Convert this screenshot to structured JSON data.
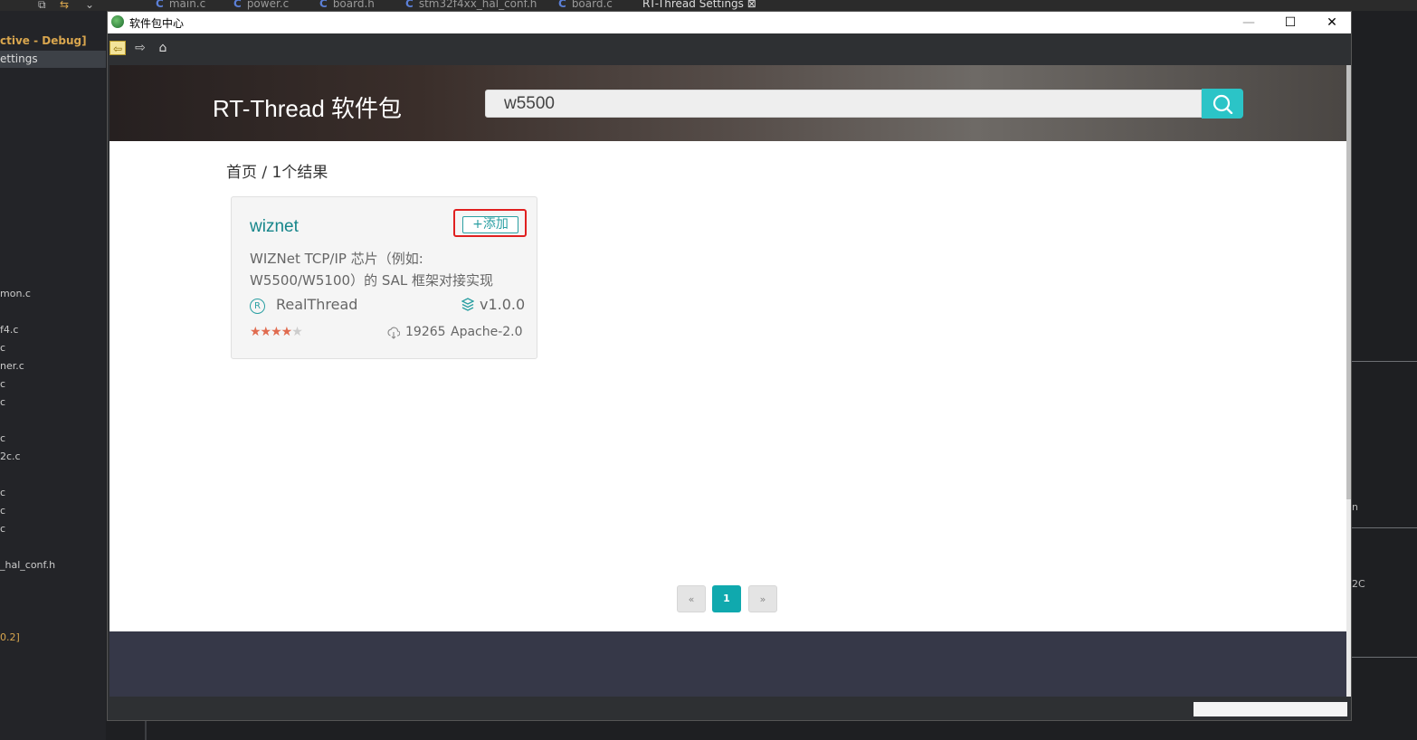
{
  "ide": {
    "tabs": [
      "main.c",
      "power.c",
      "board.h",
      "stm32f4xx_hal_conf.h",
      "board.c",
      "RT-Thread Settings"
    ],
    "project": "ctive - Debug]",
    "settings_item": "ettings",
    "files": [
      "mon.c",
      "f4.c",
      "c",
      "ner.c",
      "c",
      "c",
      "c",
      "2c.c",
      "c",
      "c",
      "c",
      "_hal_conf.h",
      "0.2]"
    ],
    "right_texts": [
      "n",
      "2C"
    ]
  },
  "window": {
    "title": "软件包中心",
    "minimize": "—",
    "maximize": "☐",
    "close": "✕"
  },
  "toolbar": {
    "back_icon": "back-arrow-icon",
    "forward_icon": "forward-arrow-icon",
    "home_icon": "home-icon"
  },
  "header": {
    "title": "RT-Thread 软件包",
    "search_value": "w5500"
  },
  "breadcrumb": "首页 / 1个结果",
  "package": {
    "name": "wiznet",
    "add_label": "+添加",
    "description": "WIZNet TCP/IP 芯片（例如: W5500/W5100）的 SAL 框架对接实现",
    "author_icon": "R",
    "author": "RealThread",
    "version": "v1.0.0",
    "stars": 4.5,
    "stars_text_on": "★★★★",
    "stars_text_half": "★",
    "downloads": "19265",
    "license": "Apache-2.0"
  },
  "pagination": {
    "prev": "«",
    "current": "1",
    "next": "»"
  },
  "colors": {
    "accent": "#2bc4c7",
    "pagination_active": "#10a9ae",
    "highlight_border": "#e02020",
    "footer": "#363848"
  }
}
